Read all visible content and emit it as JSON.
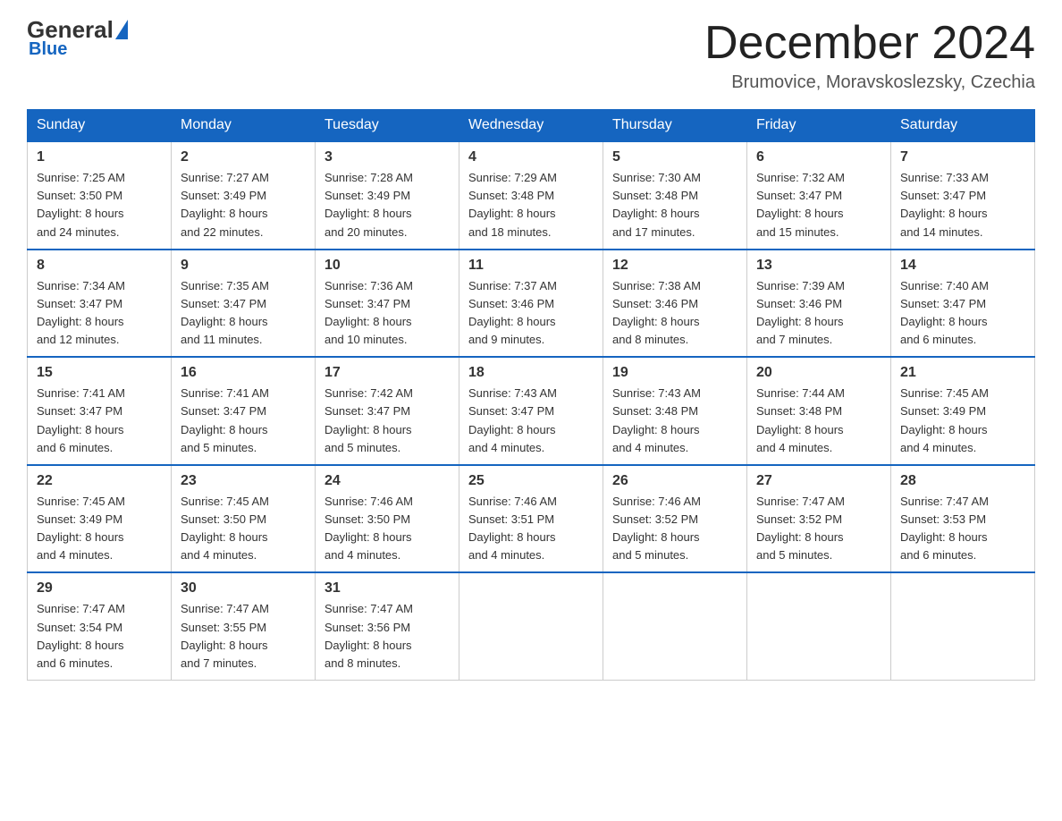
{
  "header": {
    "logo": {
      "general": "General",
      "blue": "Blue"
    },
    "title": "December 2024",
    "location": "Brumovice, Moravskoslezsky, Czechia"
  },
  "days_of_week": [
    "Sunday",
    "Monday",
    "Tuesday",
    "Wednesday",
    "Thursday",
    "Friday",
    "Saturday"
  ],
  "weeks": [
    [
      {
        "day": "1",
        "sunrise": "7:25 AM",
        "sunset": "3:50 PM",
        "daylight": "8 hours and 24 minutes."
      },
      {
        "day": "2",
        "sunrise": "7:27 AM",
        "sunset": "3:49 PM",
        "daylight": "8 hours and 22 minutes."
      },
      {
        "day": "3",
        "sunrise": "7:28 AM",
        "sunset": "3:49 PM",
        "daylight": "8 hours and 20 minutes."
      },
      {
        "day": "4",
        "sunrise": "7:29 AM",
        "sunset": "3:48 PM",
        "daylight": "8 hours and 18 minutes."
      },
      {
        "day": "5",
        "sunrise": "7:30 AM",
        "sunset": "3:48 PM",
        "daylight": "8 hours and 17 minutes."
      },
      {
        "day": "6",
        "sunrise": "7:32 AM",
        "sunset": "3:47 PM",
        "daylight": "8 hours and 15 minutes."
      },
      {
        "day": "7",
        "sunrise": "7:33 AM",
        "sunset": "3:47 PM",
        "daylight": "8 hours and 14 minutes."
      }
    ],
    [
      {
        "day": "8",
        "sunrise": "7:34 AM",
        "sunset": "3:47 PM",
        "daylight": "8 hours and 12 minutes."
      },
      {
        "day": "9",
        "sunrise": "7:35 AM",
        "sunset": "3:47 PM",
        "daylight": "8 hours and 11 minutes."
      },
      {
        "day": "10",
        "sunrise": "7:36 AM",
        "sunset": "3:47 PM",
        "daylight": "8 hours and 10 minutes."
      },
      {
        "day": "11",
        "sunrise": "7:37 AM",
        "sunset": "3:46 PM",
        "daylight": "8 hours and 9 minutes."
      },
      {
        "day": "12",
        "sunrise": "7:38 AM",
        "sunset": "3:46 PM",
        "daylight": "8 hours and 8 minutes."
      },
      {
        "day": "13",
        "sunrise": "7:39 AM",
        "sunset": "3:46 PM",
        "daylight": "8 hours and 7 minutes."
      },
      {
        "day": "14",
        "sunrise": "7:40 AM",
        "sunset": "3:47 PM",
        "daylight": "8 hours and 6 minutes."
      }
    ],
    [
      {
        "day": "15",
        "sunrise": "7:41 AM",
        "sunset": "3:47 PM",
        "daylight": "8 hours and 6 minutes."
      },
      {
        "day": "16",
        "sunrise": "7:41 AM",
        "sunset": "3:47 PM",
        "daylight": "8 hours and 5 minutes."
      },
      {
        "day": "17",
        "sunrise": "7:42 AM",
        "sunset": "3:47 PM",
        "daylight": "8 hours and 5 minutes."
      },
      {
        "day": "18",
        "sunrise": "7:43 AM",
        "sunset": "3:47 PM",
        "daylight": "8 hours and 4 minutes."
      },
      {
        "day": "19",
        "sunrise": "7:43 AM",
        "sunset": "3:48 PM",
        "daylight": "8 hours and 4 minutes."
      },
      {
        "day": "20",
        "sunrise": "7:44 AM",
        "sunset": "3:48 PM",
        "daylight": "8 hours and 4 minutes."
      },
      {
        "day": "21",
        "sunrise": "7:45 AM",
        "sunset": "3:49 PM",
        "daylight": "8 hours and 4 minutes."
      }
    ],
    [
      {
        "day": "22",
        "sunrise": "7:45 AM",
        "sunset": "3:49 PM",
        "daylight": "8 hours and 4 minutes."
      },
      {
        "day": "23",
        "sunrise": "7:45 AM",
        "sunset": "3:50 PM",
        "daylight": "8 hours and 4 minutes."
      },
      {
        "day": "24",
        "sunrise": "7:46 AM",
        "sunset": "3:50 PM",
        "daylight": "8 hours and 4 minutes."
      },
      {
        "day": "25",
        "sunrise": "7:46 AM",
        "sunset": "3:51 PM",
        "daylight": "8 hours and 4 minutes."
      },
      {
        "day": "26",
        "sunrise": "7:46 AM",
        "sunset": "3:52 PM",
        "daylight": "8 hours and 5 minutes."
      },
      {
        "day": "27",
        "sunrise": "7:47 AM",
        "sunset": "3:52 PM",
        "daylight": "8 hours and 5 minutes."
      },
      {
        "day": "28",
        "sunrise": "7:47 AM",
        "sunset": "3:53 PM",
        "daylight": "8 hours and 6 minutes."
      }
    ],
    [
      {
        "day": "29",
        "sunrise": "7:47 AM",
        "sunset": "3:54 PM",
        "daylight": "8 hours and 6 minutes."
      },
      {
        "day": "30",
        "sunrise": "7:47 AM",
        "sunset": "3:55 PM",
        "daylight": "8 hours and 7 minutes."
      },
      {
        "day": "31",
        "sunrise": "7:47 AM",
        "sunset": "3:56 PM",
        "daylight": "8 hours and 8 minutes."
      },
      null,
      null,
      null,
      null
    ]
  ],
  "labels": {
    "sunrise": "Sunrise:",
    "sunset": "Sunset:",
    "daylight": "Daylight:"
  }
}
